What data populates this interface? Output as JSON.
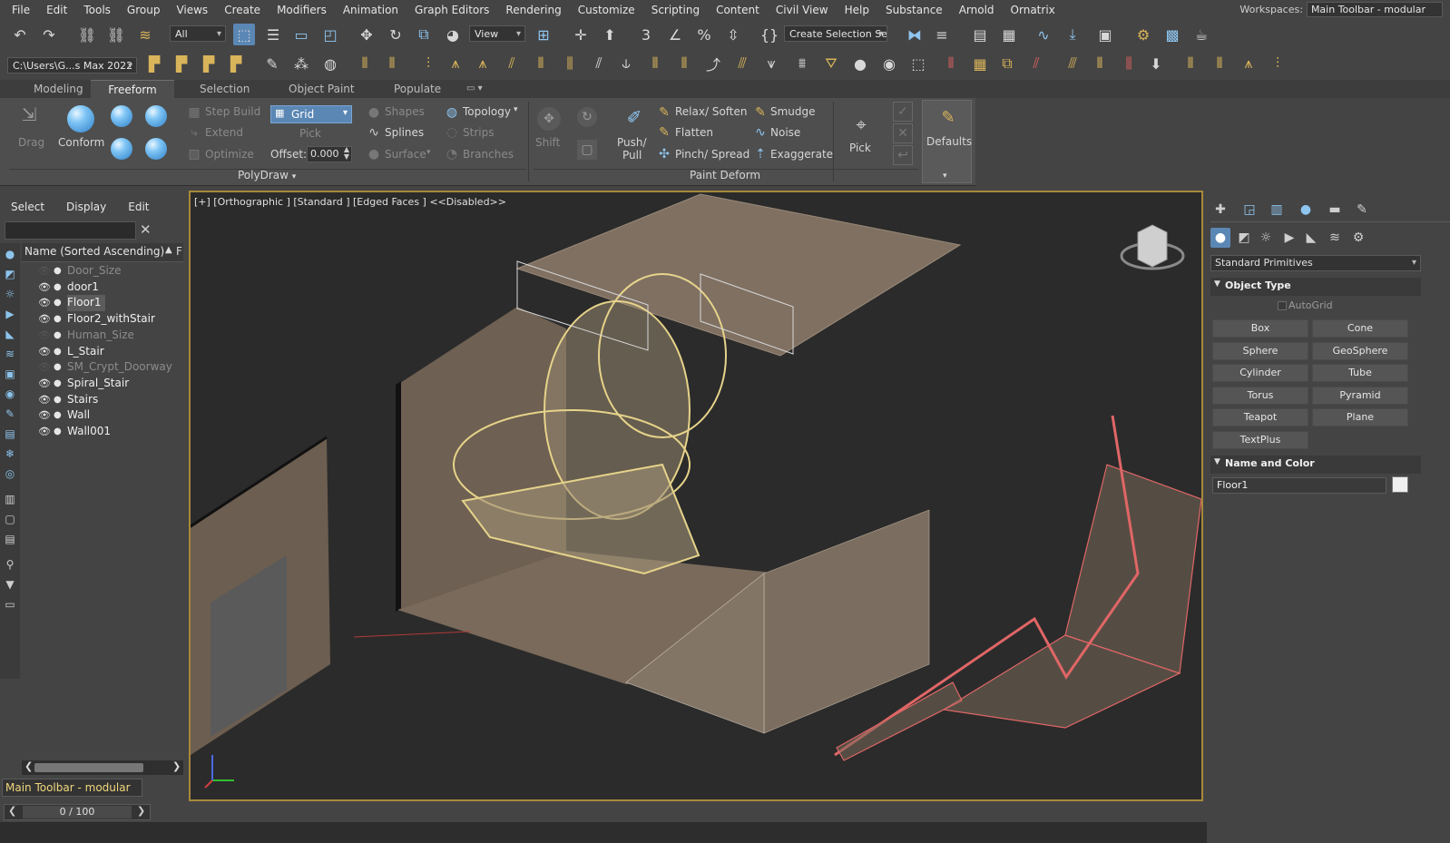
{
  "menu": {
    "items": [
      "File",
      "Edit",
      "Tools",
      "Group",
      "Views",
      "Create",
      "Modifiers",
      "Animation",
      "Graph Editors",
      "Rendering",
      "Customize",
      "Scripting",
      "Content",
      "Civil View",
      "Help",
      "Substance",
      "Arnold",
      "Ornatrix"
    ],
    "workspace_label": "Workspaces:",
    "workspace_value": "Main Toolbar - modular"
  },
  "toolbar": {
    "filter_value": "All",
    "coord_value": "View",
    "selection_set_placeholder": "Create Selection Se",
    "project_path": "C:\\Users\\G...s Max 2022"
  },
  "ribbon": {
    "tabs": [
      "Modeling",
      "Freeform",
      "Selection",
      "Object Paint",
      "Populate"
    ],
    "active_tab": "Freeform",
    "drag_label": "Drag",
    "conform_label": "Conform",
    "step_build": "Step Build",
    "extend": "Extend",
    "optimize": "Optimize",
    "grid_value": "Grid",
    "pick_label": "Pick",
    "offset_label": "Offset:",
    "offset_value": "0.000",
    "shapes": "Shapes",
    "splines": "Splines",
    "surface": "Surface",
    "topology": "Topology",
    "strips": "Strips",
    "branches": "Branches",
    "polydraw_title": "PolyDraw",
    "shift_label": "Shift",
    "push_pull_line1": "Push/",
    "push_pull_line2": "Pull",
    "relax_soften": "Relax/ Soften",
    "flatten": "Flatten",
    "pinch_spread": "Pinch/ Spread",
    "smudge": "Smudge",
    "noise": "Noise",
    "exaggerate": "Exaggerate",
    "pick2_label": "Pick",
    "paint_deform_title": "Paint Deform",
    "defaults_label": "Defaults"
  },
  "explorer": {
    "menu": [
      "Select",
      "Display",
      "Edit"
    ],
    "header_label": "Name (Sorted Ascending)",
    "header_f": "F",
    "objects": [
      {
        "name": "Door_Size",
        "hidden": true,
        "selected": false
      },
      {
        "name": "door1",
        "hidden": false,
        "selected": false
      },
      {
        "name": "Floor1",
        "hidden": false,
        "selected": true
      },
      {
        "name": "Floor2_withStair",
        "hidden": false,
        "selected": false
      },
      {
        "name": "Human_Size",
        "hidden": true,
        "selected": false
      },
      {
        "name": "L_Stair",
        "hidden": false,
        "selected": false
      },
      {
        "name": "SM_Crypt_Doorway",
        "hidden": true,
        "selected": false
      },
      {
        "name": "Spiral_Stair",
        "hidden": false,
        "selected": false
      },
      {
        "name": "Stairs",
        "hidden": false,
        "selected": false
      },
      {
        "name": "Wall",
        "hidden": false,
        "selected": false
      },
      {
        "name": "Wall001",
        "hidden": false,
        "selected": false
      }
    ]
  },
  "bottom": {
    "workspace_value": "Main Toolbar - modular",
    "timeline_value": "0 / 100"
  },
  "viewport": {
    "label": "[+] [Orthographic ] [Standard ] [Edged Faces ]  <<Disabled>>"
  },
  "command_panel": {
    "category": "Standard Primitives",
    "object_type_title": "Object Type",
    "autogrid_label": "AutoGrid",
    "primitives": [
      "Box",
      "Cone",
      "Sphere",
      "GeoSphere",
      "Cylinder",
      "Tube",
      "Torus",
      "Pyramid",
      "Teapot",
      "Plane",
      "TextPlus"
    ],
    "name_color_title": "Name and Color",
    "object_name": "Floor1",
    "object_color": "#f0f0f0"
  },
  "colors": {
    "selection_blue": "#5b87b5",
    "viewport_border": "#a7893a",
    "selected_wire": "#e6d38a",
    "red_wire": "#e06666"
  }
}
